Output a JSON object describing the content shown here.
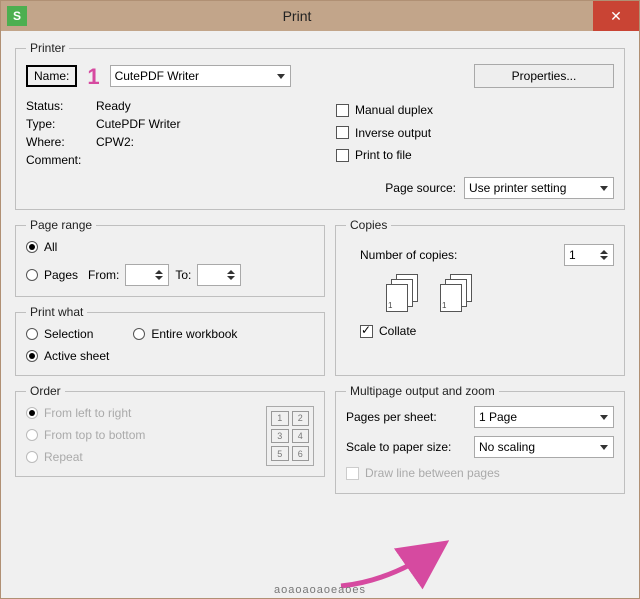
{
  "window": {
    "title": "Print",
    "app_icon_label": "S"
  },
  "annotation": {
    "marker1": "1",
    "arrow_color": "#d64aa0"
  },
  "printer": {
    "legend": "Printer",
    "name_label": "Name:",
    "name_value": "CutePDF Writer",
    "properties_button": "Properties...",
    "status_label": "Status:",
    "status_value": "Ready",
    "type_label": "Type:",
    "type_value": "CutePDF Writer",
    "where_label": "Where:",
    "where_value": "CPW2:",
    "comment_label": "Comment:",
    "comment_value": "",
    "manual_duplex": "Manual duplex",
    "inverse_output": "Inverse output",
    "print_to_file": "Print to file",
    "page_source_label": "Page source:",
    "page_source_value": "Use printer setting"
  },
  "page_range": {
    "legend": "Page range",
    "all": "All",
    "pages": "Pages",
    "from_label": "From:",
    "to_label": "To:",
    "from_value": "",
    "to_value": ""
  },
  "copies": {
    "legend": "Copies",
    "number_label": "Number of copies:",
    "number_value": "1",
    "collate": "Collate"
  },
  "print_what": {
    "legend": "Print what",
    "selection": "Selection",
    "entire_workbook": "Entire workbook",
    "active_sheet": "Active sheet"
  },
  "order": {
    "legend": "Order",
    "left_to_right": "From left to right",
    "top_to_bottom": "From top to bottom",
    "repeat": "Repeat",
    "cells": [
      "1",
      "2",
      "3",
      "4",
      "5",
      "6"
    ]
  },
  "multipage": {
    "legend": "Multipage output and zoom",
    "pages_per_sheet_label": "Pages per sheet:",
    "pages_per_sheet_value": "1 Page",
    "scale_label": "Scale to paper size:",
    "scale_value": "No scaling",
    "draw_line": "Draw line between pages"
  },
  "garbled_text": "aoaoaoaoeaoes"
}
